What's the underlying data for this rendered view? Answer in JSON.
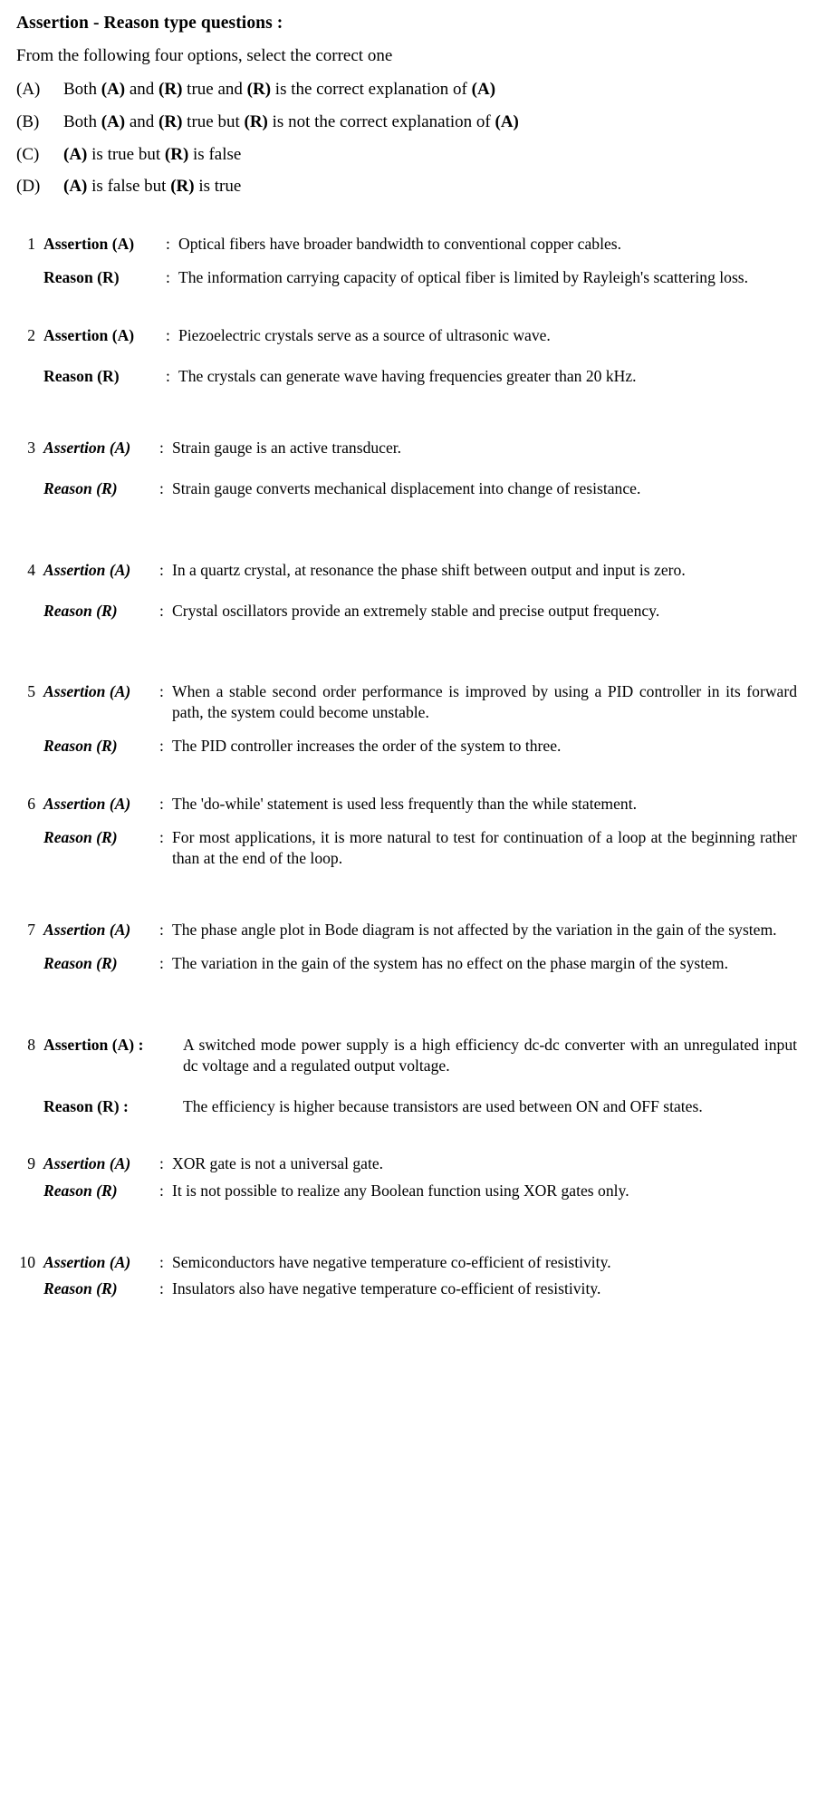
{
  "header": {
    "title": "Assertion - Reason type questions :",
    "instruction": "From the following four options, select the correct one",
    "options": [
      {
        "key": "(A)",
        "parts": [
          {
            "t": "Both ",
            "b": false
          },
          {
            "t": "(A)",
            "b": true
          },
          {
            "t": " and ",
            "b": false
          },
          {
            "t": "(R)",
            "b": true
          },
          {
            "t": " true and ",
            "b": false
          },
          {
            "t": "(R)",
            "b": true
          },
          {
            "t": " is the correct explanation of ",
            "b": false
          },
          {
            "t": "(A)",
            "b": true
          }
        ]
      },
      {
        "key": "(B)",
        "parts": [
          {
            "t": "Both ",
            "b": false
          },
          {
            "t": "(A)",
            "b": true
          },
          {
            "t": " and ",
            "b": false
          },
          {
            "t": "(R)",
            "b": true
          },
          {
            "t": " true but ",
            "b": false
          },
          {
            "t": "(R)",
            "b": true
          },
          {
            "t": " is not the correct explanation of ",
            "b": false
          },
          {
            "t": "(A)",
            "b": true
          }
        ]
      },
      {
        "key": "(C)",
        "parts": [
          {
            "t": "(A)",
            "b": true
          },
          {
            "t": " is true but ",
            "b": false
          },
          {
            "t": "(R)",
            "b": true
          },
          {
            "t": " is false",
            "b": false
          }
        ]
      },
      {
        "key": "(D)",
        "parts": [
          {
            "t": "(A)",
            "b": true
          },
          {
            "t": " is false but ",
            "b": false
          },
          {
            "t": "(R)",
            "b": true
          },
          {
            "t": " is true",
            "b": false
          }
        ]
      }
    ]
  },
  "questions": [
    {
      "number": "1",
      "style": "bold",
      "colon_in_label": false,
      "assertion_label": "Assertion (A)",
      "assertion_text": "Optical fibers have broader bandwidth to conventional copper cables.",
      "reason_label": "Reason (R)",
      "reason_text": "The information carrying capacity of optical fiber is limited by Rayleigh's scattering loss."
    },
    {
      "number": "2",
      "style": "bold",
      "colon_in_label": false,
      "assertion_label": "Assertion (A)",
      "assertion_text": "Piezoelectric crystals serve as a source of ultrasonic wave.",
      "reason_label": "Reason (R)",
      "reason_text": "The crystals can generate wave having frequencies greater than 20 kHz."
    },
    {
      "number": "3",
      "style": "italic",
      "colon_in_label": false,
      "assertion_label": "Assertion (A)",
      "assertion_text": "Strain gauge is an active transducer.",
      "reason_label": "Reason (R)",
      "reason_text": "Strain gauge converts mechanical displacement into change of resistance."
    },
    {
      "number": "4",
      "style": "italic",
      "colon_in_label": false,
      "assertion_label": "Assertion (A)",
      "assertion_text": "In a quartz crystal, at resonance the phase shift between output and input is zero.",
      "reason_label": "Reason (R)",
      "reason_text": "Crystal oscillators provide an extremely stable and precise output frequency."
    },
    {
      "number": "5",
      "style": "italic",
      "colon_in_label": false,
      "assertion_label": "Assertion (A)",
      "assertion_text": "When a stable second order performance is improved by using a PID controller in its forward path, the system could become unstable.",
      "reason_label": "Reason (R)",
      "reason_text": "The PID controller increases the order of the system to three."
    },
    {
      "number": "6",
      "style": "italic",
      "colon_in_label": false,
      "assertion_label": "Assertion (A)",
      "assertion_text": "The 'do-while' statement is used less frequently than the while statement.",
      "reason_label": "Reason (R)",
      "reason_text": "For most applications, it is more natural to test for continuation of a loop at the beginning rather than at the end of the loop."
    },
    {
      "number": "7",
      "style": "italic",
      "colon_in_label": false,
      "assertion_label": "Assertion (A)",
      "assertion_text": "The phase angle plot in Bode diagram is not affected by the variation in the gain of the system.",
      "reason_label": "Reason (R)",
      "reason_text": "The variation in the gain of the system has no effect on the phase margin of the system."
    },
    {
      "number": "8",
      "style": "bold",
      "colon_in_label": true,
      "assertion_label": "Assertion (A) :",
      "assertion_text": "A switched mode power supply is a high efficiency dc-dc converter with an unregulated input dc voltage and a regulated output voltage.",
      "reason_label": "Reason (R) :",
      "reason_text": "The efficiency is higher because transistors are used between ON and OFF states."
    },
    {
      "number": "9",
      "style": "italic",
      "colon_in_label": false,
      "assertion_label": "Assertion (A)",
      "assertion_text": "XOR gate is not a universal gate.",
      "reason_label": "Reason (R)",
      "reason_text": "It is not possible to realize any Boolean function using XOR gates only."
    },
    {
      "number": "10",
      "style": "italic",
      "colon_in_label": false,
      "assertion_label": "Assertion (A)",
      "assertion_text": "Semiconductors have negative temperature co-efficient of resistivity.",
      "reason_label": "Reason (R)",
      "reason_text": "Insulators also have negative temperature co-efficient of resistivity."
    }
  ],
  "glyphs": {
    "colon": ":"
  },
  "layout": {
    "reason_gaps": [
      "md",
      "lg",
      "lg",
      "lg",
      "md",
      "md",
      "md",
      "lg",
      "sm",
      "sm"
    ],
    "block_gaps": [
      "md",
      "lg",
      "xl",
      "xl",
      "md",
      "lg",
      "xl",
      "md",
      "lg",
      ""
    ],
    "label_widths": {
      "1": 135,
      "2": 135,
      "3": 128,
      "4": 128,
      "5": 128,
      "6": 128,
      "7": 128,
      "8": 140,
      "9": 128,
      "10": 128
    }
  }
}
